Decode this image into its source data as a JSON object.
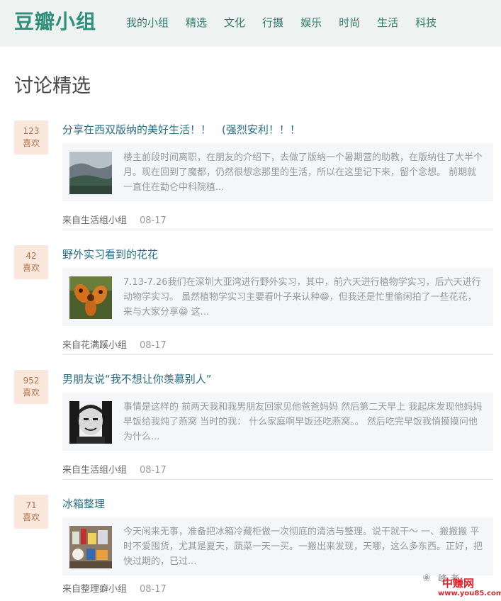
{
  "header": {
    "logo": "豆瓣小组",
    "nav": [
      "我的小组",
      "精选",
      "文化",
      "行摄",
      "娱乐",
      "时尚",
      "生活",
      "科技"
    ]
  },
  "page_title": "讨论精选",
  "posts": [
    {
      "likes_count": "123",
      "likes_label": "喜欢",
      "title": "分享在西双版纳的美好生活！！　(强烈安利！！！",
      "summary": "楼主前段时间离职，在朋友的介绍下，去做了版纳一个暑期营的助教，在版纳住了大半个月。现在回到了魔都，仍然很想念那里的生活，所以在这里记下来，留个念想。 前期就一直住在勐仑中科院植...",
      "source": "来自生活组小组",
      "date": "08-17"
    },
    {
      "likes_count": "42",
      "likes_label": "喜欢",
      "title": "野外实习看到的花花",
      "summary": "7.13-7.26我们在深圳大亚湾进行野外实习，其中，前六天进行植物学实习，后六天进行动物学实习。 虽然植物学实习主要看叶子来认种😁，但我还是忙里偷闲拍了一些花花，来与大家分享😁 这...",
      "source": "来自花满蹊小组",
      "date": "08-17"
    },
    {
      "likes_count": "952",
      "likes_label": "喜欢",
      "title": "男朋友说“我不想让你羡慕别人”",
      "summary": "事情是这样的 前两天我和我男朋友回家见他爸爸妈妈 然后第二天早上 我起床发现他妈妈早饭给我炖了燕窝 当时的我： 什么家庭啊早饭还吃燕窝。。 然后吃完早饭我悄摸摸问他为什么...",
      "source": "来自生活组小组",
      "date": "08-17"
    },
    {
      "likes_count": "71",
      "likes_label": "喜欢",
      "title": "冰箱整理",
      "summary": "今天闲来无事，准备把冰箱冷藏柜做一次彻底的清洁与整理。说干就干～ 一、搬搬搬 平时不爱囤货，尤其是夏天，蔬菜一天一买。一搬出来发现，天哪，这么多东西。正好，把快过期的，已过...",
      "source": "来自整理癖小组",
      "date": "08-17"
    }
  ],
  "watermark": {
    "name": "峰 老",
    "logo_text": "中赚网",
    "url": "www.you85.com"
  }
}
